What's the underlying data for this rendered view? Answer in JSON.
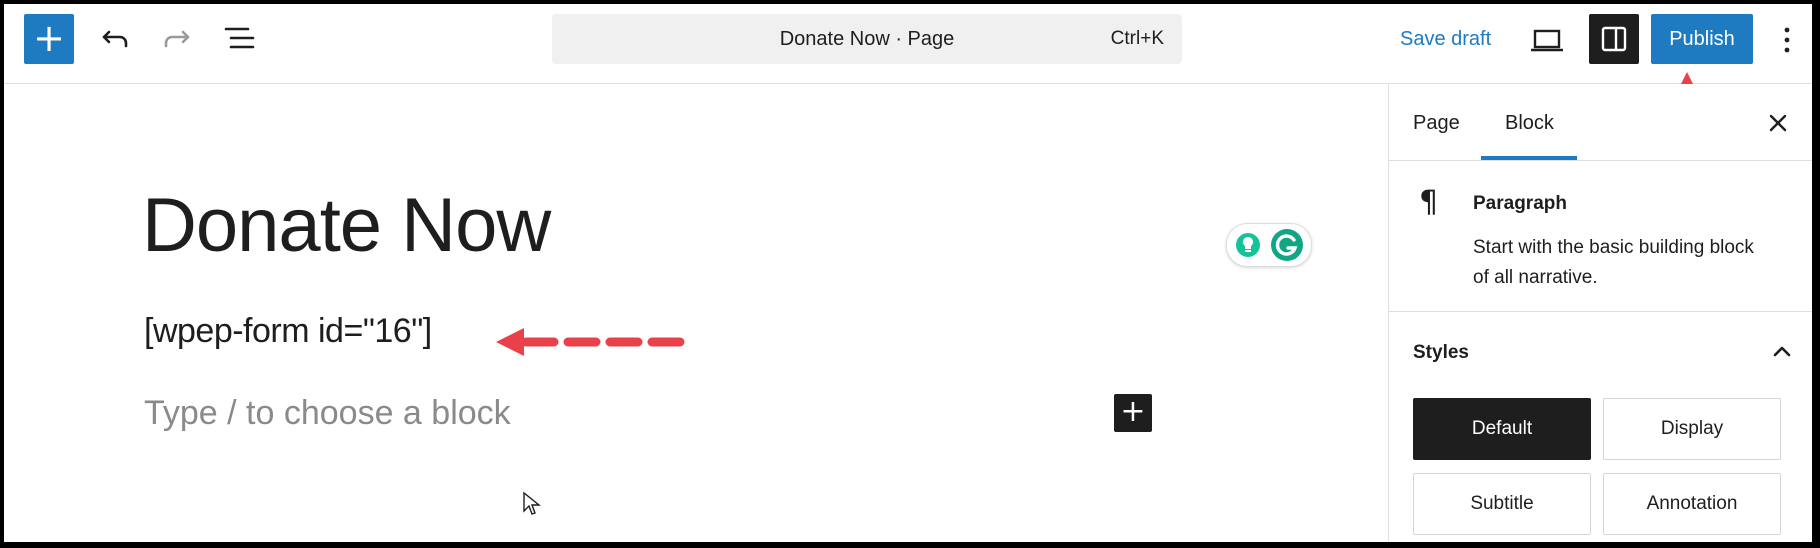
{
  "toolbar": {
    "add_symbol": "+",
    "document_title": "Donate Now · Page",
    "shortcut": "Ctrl+K",
    "save_draft_label": "Save draft",
    "publish_label": "Publish"
  },
  "editor": {
    "post_title": "Donate Now",
    "shortcode_block": "[wpep-form id=\"16\"]",
    "block_placeholder": "Type / to choose a block",
    "inserter_symbol": "+"
  },
  "sidebar": {
    "tabs": [
      {
        "label": "Page",
        "active": false
      },
      {
        "label": "Block",
        "active": true
      }
    ],
    "block": {
      "icon": "¶",
      "name": "Paragraph",
      "description": "Start with the basic building block of all narrative."
    },
    "styles": {
      "heading": "Styles",
      "options": [
        {
          "label": "Default",
          "active": true
        },
        {
          "label": "Display",
          "active": false
        },
        {
          "label": "Subtitle",
          "active": false
        },
        {
          "label": "Annotation",
          "active": false
        }
      ]
    }
  },
  "colors": {
    "accent": "#1e7bc1",
    "annotation_arrow": "#e8414a",
    "grammarly_green": "#15c39a",
    "dark": "#1e1e1e"
  }
}
